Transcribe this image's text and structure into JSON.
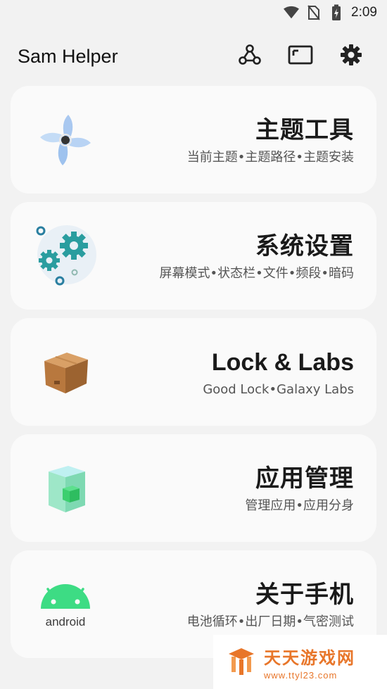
{
  "status_bar": {
    "time": "2:09",
    "icons": [
      "wifi-icon",
      "no-sim-icon",
      "battery-charging-icon"
    ]
  },
  "app_bar": {
    "title": "Sam Helper",
    "actions": [
      "share-nodes-icon",
      "window-icon",
      "gear-icon"
    ]
  },
  "cards": [
    {
      "title": "主题工具",
      "subtitle": "当前主题•主题路径•主题安装",
      "icon": "pinwheel-icon"
    },
    {
      "title": "系统设置",
      "subtitle": "屏幕模式•状态栏•文件•频段•暗码",
      "icon": "gears-icon"
    },
    {
      "title": "Lock & Labs",
      "subtitle": "Good Lock•Galaxy Labs",
      "icon": "box-icon"
    },
    {
      "title": "应用管理",
      "subtitle": "管理应用•应用分身",
      "icon": "cube-icon"
    },
    {
      "title": "关于手机",
      "subtitle": "电池循环•出厂日期•气密测试",
      "icon": "android-icon",
      "icon_label": "android"
    }
  ],
  "watermark": {
    "main": "天天游戏网",
    "sub": "www.ttyl23.com"
  },
  "colors": {
    "background": "#f2f2f2",
    "card": "#fafafa",
    "gear_teal": "#2a9d9f",
    "android_green": "#3ddc84",
    "watermark_orange": "#e8762a"
  }
}
